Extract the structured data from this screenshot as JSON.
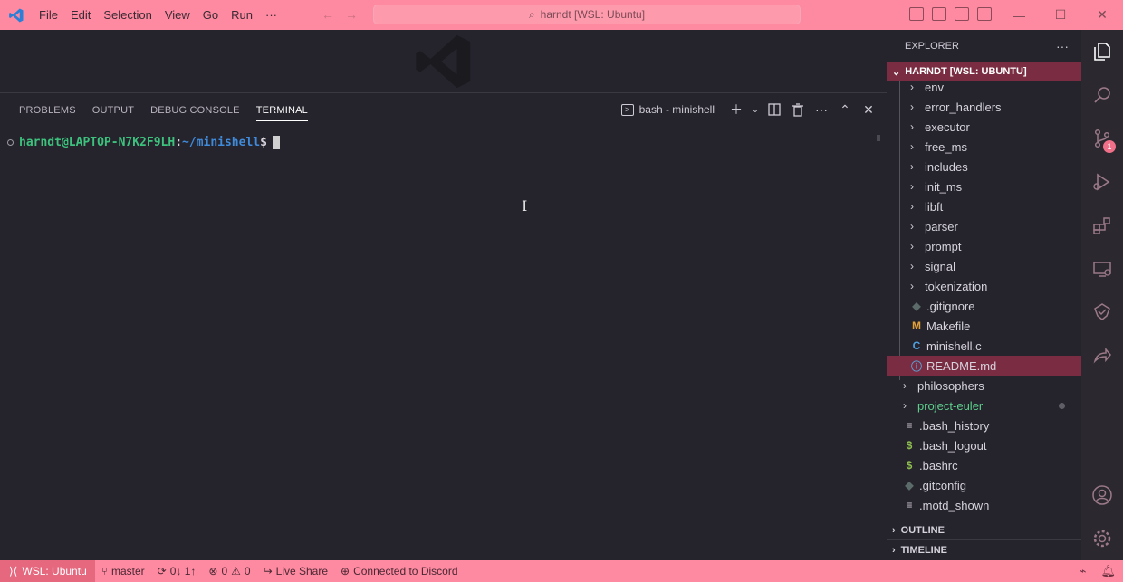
{
  "titlebar": {
    "menu": [
      "File",
      "Edit",
      "Selection",
      "View",
      "Go",
      "Run",
      "···"
    ],
    "search": "harndt [WSL: Ubuntu]"
  },
  "panel": {
    "tabs": [
      "PROBLEMS",
      "OUTPUT",
      "DEBUG CONSOLE",
      "TERMINAL"
    ],
    "active_tab": "TERMINAL",
    "terminal_select": "bash - minishell"
  },
  "terminal": {
    "user": "harndt@LAPTOP-N7K2F9LH",
    "colon": ":",
    "path": "~/minishell",
    "dollar": "$"
  },
  "explorer": {
    "title": "EXPLORER",
    "root": "HARNDT [WSL: UBUNTU]",
    "items": [
      {
        "label": "env",
        "kind": "folder",
        "depth": 1
      },
      {
        "label": "error_handlers",
        "kind": "folder",
        "depth": 1
      },
      {
        "label": "executor",
        "kind": "folder",
        "depth": 1
      },
      {
        "label": "free_ms",
        "kind": "folder",
        "depth": 1
      },
      {
        "label": "includes",
        "kind": "folder",
        "depth": 1
      },
      {
        "label": "init_ms",
        "kind": "folder",
        "depth": 1
      },
      {
        "label": "libft",
        "kind": "folder",
        "depth": 1
      },
      {
        "label": "parser",
        "kind": "folder",
        "depth": 1
      },
      {
        "label": "prompt",
        "kind": "folder",
        "depth": 1
      },
      {
        "label": "signal",
        "kind": "folder",
        "depth": 1
      },
      {
        "label": "tokenization",
        "kind": "folder",
        "depth": 1
      },
      {
        "label": ".gitignore",
        "kind": "git-file",
        "depth": 1
      },
      {
        "label": "Makefile",
        "kind": "makefile",
        "depth": 1
      },
      {
        "label": "minishell.c",
        "kind": "c-file",
        "depth": 1
      },
      {
        "label": "README.md",
        "kind": "info-file",
        "depth": 1,
        "selected": true
      },
      {
        "label": "philosophers",
        "kind": "folder",
        "depth": 0
      },
      {
        "label": "project-euler",
        "kind": "folder",
        "depth": 0,
        "modified": true
      },
      {
        "label": ".bash_history",
        "kind": "text-file",
        "depth": 0
      },
      {
        "label": ".bash_logout",
        "kind": "shell-file",
        "depth": 0
      },
      {
        "label": ".bashrc",
        "kind": "shell-file",
        "depth": 0
      },
      {
        "label": ".gitconfig",
        "kind": "git-file",
        "depth": 0
      },
      {
        "label": ".motd_shown",
        "kind": "text-file",
        "depth": 0
      }
    ],
    "outline": "OUTLINE",
    "timeline": "TIMELINE"
  },
  "activity": {
    "scm_badge": "1"
  },
  "status": {
    "remote": "WSL: Ubuntu",
    "branch": "master",
    "sync": "0↓ 1↑",
    "errors": "0",
    "warnings": "0",
    "live_share": "Live Share",
    "discord": "Connected to Discord"
  },
  "colors": {
    "accent": "#fd8aa0",
    "selection": "#7a2d42",
    "background": "#25232b"
  }
}
